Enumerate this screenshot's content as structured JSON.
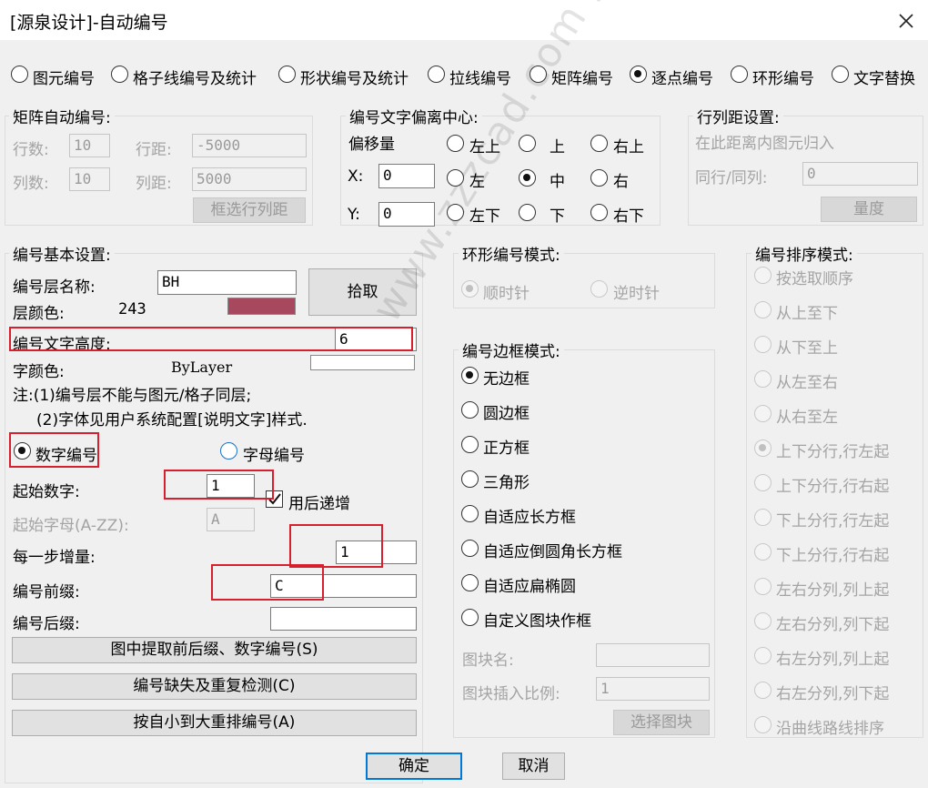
{
  "window": {
    "title": "[源泉设计]-自动编号"
  },
  "modes": [
    {
      "label": "图元编号",
      "checked": false
    },
    {
      "label": "格子线编号及统计",
      "checked": false
    },
    {
      "label": "形状编号及统计",
      "checked": false
    },
    {
      "label": "拉线编号",
      "checked": false
    },
    {
      "label": "矩阵编号",
      "checked": false
    },
    {
      "label": "逐点编号",
      "checked": true
    },
    {
      "label": "环形编号",
      "checked": false
    },
    {
      "label": "文字替换",
      "checked": false
    }
  ],
  "matrix": {
    "title": "矩阵自动编号:",
    "rows_label": "行数:",
    "rows_value": "10",
    "row_dist_label": "行距:",
    "row_dist_value": "-5000",
    "cols_label": "列数:",
    "cols_value": "10",
    "col_dist_label": "列距:",
    "col_dist_value": "5000",
    "select_btn": "框选行列距"
  },
  "offset": {
    "title": "编号文字偏离中心:",
    "offset_label": "偏移量",
    "x_label": "X:",
    "x_value": "0",
    "y_label": "Y:",
    "y_value": "0",
    "positions": [
      "左上",
      "上",
      "右上",
      "左",
      "中",
      "右",
      "左下",
      "下",
      "右下"
    ],
    "selected": "中"
  },
  "spacing": {
    "title": "行列距设置:",
    "hint": "在此距离内图元归入",
    "same_label": "同行/同列:",
    "same_value": "0",
    "measure_btn": "量度"
  },
  "basic": {
    "title": "编号基本设置:",
    "layer_label": "编号层名称:",
    "layer_value": "BH",
    "pick_btn": "拾取",
    "color_label": "层颜色:",
    "color_value": "243",
    "color_swatch": "#a8485e",
    "height_label": "编号文字高度:",
    "height_value": "6",
    "font_color_label": "字颜色:",
    "font_color_value": "ByLayer",
    "note1": "注:(1)编号层不能与图元/格子同层;",
    "note2": "(2)字体见用户系统配置[说明文字]样式.",
    "num_label": "数字编号",
    "alpha_label": "字母编号",
    "start_num_label": "起始数字:",
    "start_num_value": "1",
    "auto_inc_label": "用后递增",
    "start_alpha_label": "起始字母(A-ZZ):",
    "start_alpha_value": "A",
    "step_label": "每一步增量:",
    "step_value": "1",
    "prefix_label": "编号前缀:",
    "prefix_value": "C",
    "suffix_label": "编号后缀:",
    "suffix_value": "",
    "extract_btn": "图中提取前后缀、数字编号(S)",
    "check_btn": "编号缺失及重复检测(C)",
    "renumber_btn": "按自小到大重排编号(A)"
  },
  "ring": {
    "title": "环形编号模式:",
    "cw": "顺时针",
    "ccw": "逆时针"
  },
  "border": {
    "title": "编号边框模式:",
    "options": [
      "无边框",
      "圆边框",
      "正方框",
      "三角形",
      "自适应长方框",
      "自适应倒圆角长方框",
      "自适应扁椭圆",
      "自定义图块作框"
    ],
    "selected": "无边框",
    "block_name_label": "图块名:",
    "block_name_value": "",
    "block_scale_label": "图块插入比例:",
    "block_scale_value": "1",
    "select_block_btn": "选择图块"
  },
  "sort": {
    "title": "编号排序模式:",
    "options": [
      "按选取顺序",
      "从上至下",
      "从下至上",
      "从左至右",
      "从右至左",
      "上下分行,行左起",
      "上下分行,行右起",
      "下上分行,行左起",
      "下上分行,行右起",
      "左右分列,列上起",
      "左右分列,列下起",
      "右左分列,列上起",
      "右左分列,列下起",
      "沿曲线路线排序"
    ],
    "selected": "上下分行,行左起"
  },
  "footer": {
    "ok": "确定",
    "cancel": "取消"
  },
  "watermark": "www.zzzcad.com  周站长CAD"
}
